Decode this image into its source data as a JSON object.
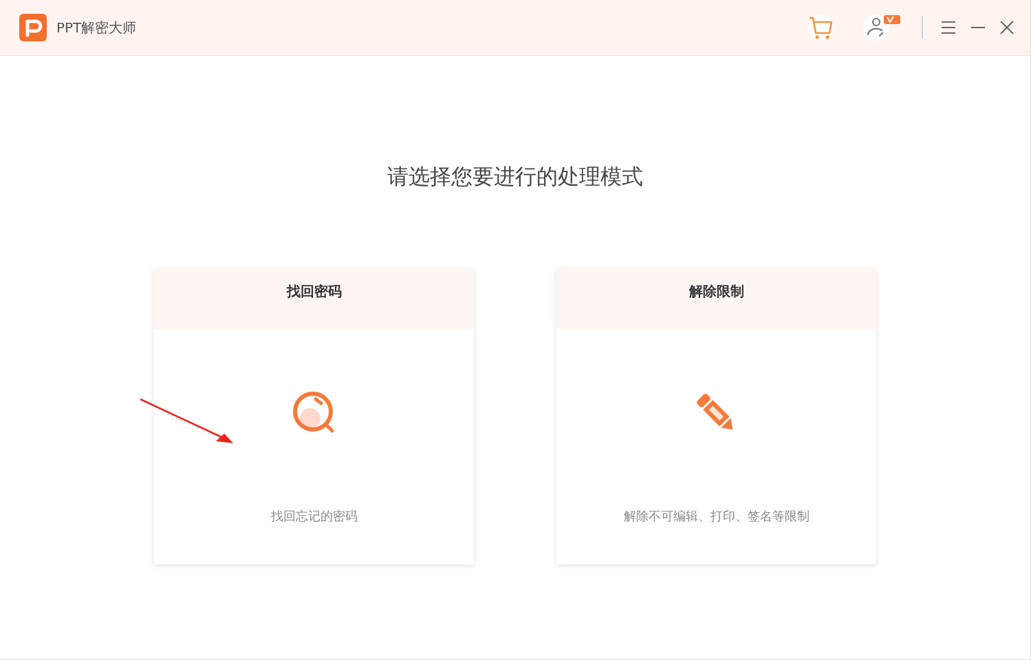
{
  "window": {
    "title": "PPT解密大师"
  },
  "heading": "请选择您要进行的处理模式",
  "modes": [
    {
      "kind": "recover",
      "title": "找回密码",
      "description": "找回忘记的密码"
    },
    {
      "kind": "unlock",
      "title": "解除限制",
      "description": "解除不可编辑、打印、签名等限制"
    }
  ]
}
